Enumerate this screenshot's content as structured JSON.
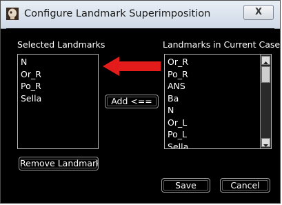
{
  "window": {
    "title": "Configure Landmark Superimposition",
    "close_symbol": "X",
    "app_icon": "landmark-app-icon"
  },
  "selected": {
    "label": "Selected Landmarks",
    "items": [
      "N",
      "Or_R",
      "Po_R",
      "Sella"
    ]
  },
  "current": {
    "label": "Landmarks in Current Case",
    "items": [
      "Or_R",
      "Po_R",
      "ANS",
      "Ba",
      "N",
      "Or_L",
      "Po_L",
      "Sella"
    ]
  },
  "buttons": {
    "add": "Add <==",
    "remove": "Remove Landmark",
    "save": "Save",
    "cancel": "Cancel"
  },
  "annotation": {
    "arrow_color": "#e31b1b",
    "arrow_direction": "left"
  }
}
